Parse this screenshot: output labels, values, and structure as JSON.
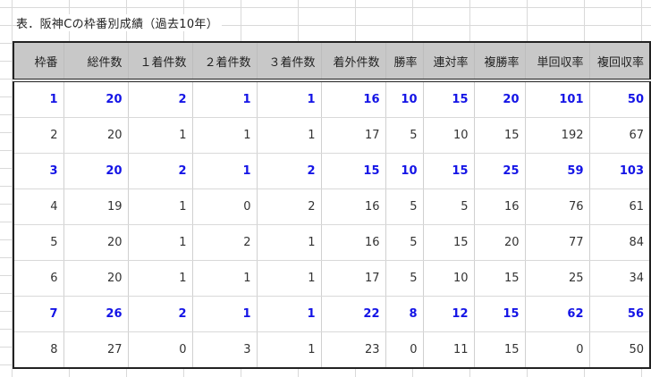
{
  "caption": "表．阪神Cの枠番別成績（過去10年）",
  "colors": {
    "highlight": "#1414e6",
    "header_bg": "#c8c8c8",
    "border": "#222222"
  },
  "headers": [
    "枠番",
    "総件数",
    "１着件数",
    "２着件数",
    "３着件数",
    "着外件数",
    "勝率",
    "連対率",
    "複勝率",
    "単回収率",
    "複回収率"
  ],
  "rows": [
    {
      "highlight": true,
      "cells": [
        "1",
        "20",
        "2",
        "1",
        "1",
        "16",
        "10",
        "15",
        "20",
        "101",
        "50"
      ]
    },
    {
      "highlight": false,
      "cells": [
        "2",
        "20",
        "1",
        "1",
        "1",
        "17",
        "5",
        "10",
        "15",
        "192",
        "67"
      ]
    },
    {
      "highlight": true,
      "cells": [
        "3",
        "20",
        "2",
        "1",
        "2",
        "15",
        "10",
        "15",
        "25",
        "59",
        "103"
      ]
    },
    {
      "highlight": false,
      "cells": [
        "4",
        "19",
        "1",
        "0",
        "2",
        "16",
        "5",
        "5",
        "16",
        "76",
        "61"
      ]
    },
    {
      "highlight": false,
      "cells": [
        "5",
        "20",
        "1",
        "2",
        "1",
        "16",
        "5",
        "15",
        "20",
        "77",
        "84"
      ]
    },
    {
      "highlight": false,
      "cells": [
        "6",
        "20",
        "1",
        "1",
        "1",
        "17",
        "5",
        "10",
        "15",
        "25",
        "34"
      ]
    },
    {
      "highlight": true,
      "cells": [
        "7",
        "26",
        "2",
        "1",
        "1",
        "22",
        "8",
        "12",
        "15",
        "62",
        "56"
      ]
    },
    {
      "highlight": false,
      "cells": [
        "8",
        "27",
        "0",
        "3",
        "1",
        "23",
        "0",
        "11",
        "15",
        "0",
        "50"
      ]
    }
  ]
}
